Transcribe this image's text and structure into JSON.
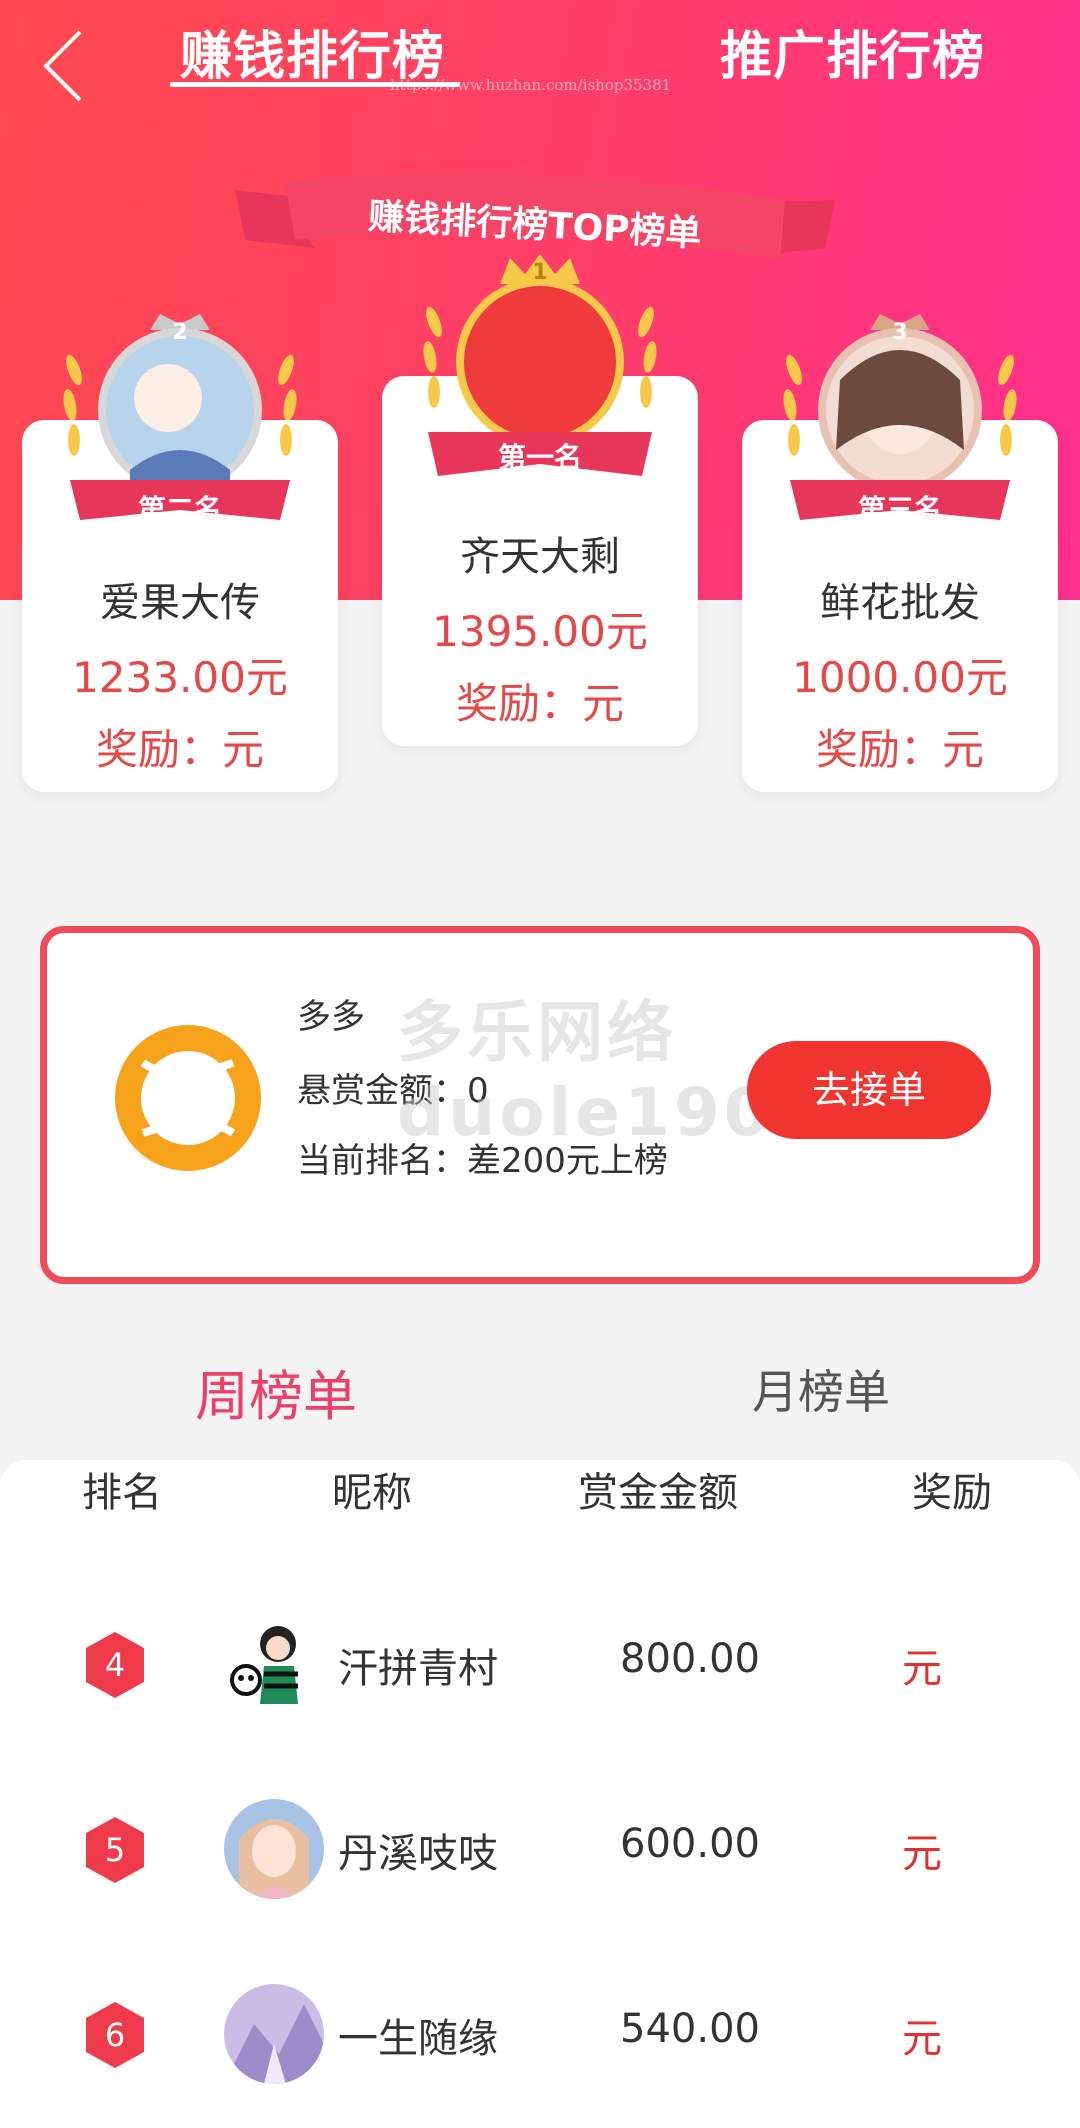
{
  "header": {
    "tab_earn": "赚钱排行榜",
    "tab_promo": "推广排行榜",
    "watermark_url": "https://www.huzhan.com/ishop35381",
    "ribbon_title": "赚钱排行榜TOP榜单"
  },
  "podium": {
    "first": {
      "badge": "第一名",
      "medal_num": "1",
      "name": "齐天大剩",
      "amount": "1395.00元",
      "reward": "奖励：元"
    },
    "second": {
      "badge": "第二名",
      "medal_num": "2",
      "name": "爱果大传",
      "amount": "1233.00元",
      "reward": "奖励：元"
    },
    "third": {
      "badge": "第三名",
      "medal_num": "3",
      "name": "鲜花批发",
      "amount": "1000.00元",
      "reward": "奖励：元"
    }
  },
  "me": {
    "name": "多多",
    "bounty": "悬赏金额：0",
    "rank": "当前排名：差200元上榜",
    "button": "去接单",
    "watermark_line1": "多乐网络",
    "watermark_line2": "duole190"
  },
  "list_tabs": {
    "week": "周榜单",
    "month": "月榜单"
  },
  "table": {
    "headers": {
      "rank": "排名",
      "nickname": "昵称",
      "amount": "赏金金额",
      "reward": "奖励"
    },
    "rows": [
      {
        "rank": "4",
        "name": "汗拼青村",
        "amount": "800.00",
        "reward": "元"
      },
      {
        "rank": "5",
        "name": "丹溪吱吱",
        "amount": "600.00",
        "reward": "元"
      },
      {
        "rank": "6",
        "name": "一生随缘",
        "amount": "540.00",
        "reward": "元"
      }
    ]
  },
  "colors": {
    "accent_red": "#e64747",
    "button_red": "#f0342f",
    "tab_pink": "#ec3f6c",
    "gold": "#f6c94a"
  }
}
